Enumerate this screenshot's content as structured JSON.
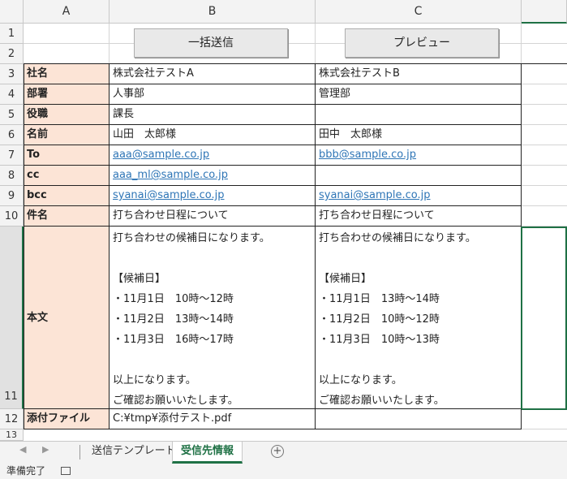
{
  "columns": [
    "A",
    "B",
    "C"
  ],
  "rows": [
    "1",
    "2",
    "3",
    "4",
    "5",
    "6",
    "7",
    "8",
    "9",
    "10",
    "11",
    "12",
    "13"
  ],
  "buttons": {
    "send_all": "一括送信",
    "preview": "プレビュー"
  },
  "labels": {
    "company": "社名",
    "department": "部署",
    "position": "役職",
    "name": "名前",
    "to": "To",
    "cc": "cc",
    "bcc": "bcc",
    "subject": "件名",
    "body": "本文",
    "attachment": "添付ファイル"
  },
  "col_b": {
    "company": "株式会社テストA",
    "department": "人事部",
    "position": "課長",
    "name": "山田　太郎様",
    "to": "aaa@sample.co.jp",
    "cc": "aaa_ml@sample.co.jp",
    "bcc": "syanai@sample.co.jp",
    "subject": "打ち合わせ日程について",
    "body": "打ち合わせの候補日になります。\n\n【候補日】\n・11月1日　10時〜12時\n・11月2日　13時〜14時\n・11月3日　16時〜17時\n\n以上になります。\nご確認お願いいたします。",
    "attachment": "C:¥tmp¥添付テスト.pdf"
  },
  "col_c": {
    "company": "株式会社テストB",
    "department": "管理部",
    "position": "",
    "name": "田中　太郎様",
    "to": "bbb@sample.co.jp",
    "cc": "",
    "bcc": "syanai@sample.co.jp",
    "subject": "打ち合わせ日程について",
    "body": "打ち合わせの候補日になります。\n\n【候補日】\n・11月1日　13時〜14時\n・11月2日　10時〜12時\n・11月3日　10時〜13時\n\n以上になります。\nご確認お願いいたします。",
    "attachment": ""
  },
  "tabs": {
    "template": "送信テンプレート",
    "recipients": "受信先情報"
  },
  "status": {
    "ready": "準備完了"
  },
  "colors": {
    "label_fill": "#fce4d6",
    "link": "#2e75b6",
    "active_tab": "#1f7145"
  }
}
